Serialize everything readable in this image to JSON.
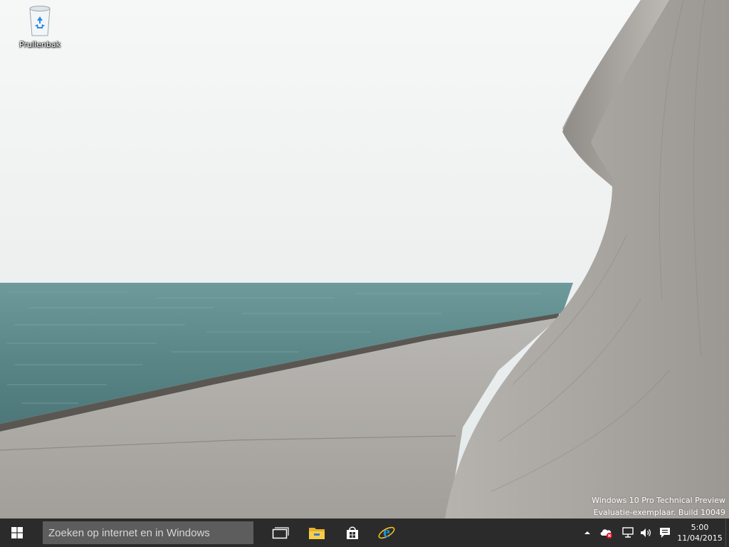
{
  "desktop": {
    "icons": [
      {
        "label": "Prullenbak",
        "icon": "recycle-bin-icon"
      }
    ],
    "watermark": {
      "line1": "Windows 10 Pro Technical Preview",
      "line2": "Evaluatie-exemplaar. Build 10049"
    }
  },
  "taskbar": {
    "start_icon": "windows-logo-icon",
    "search": {
      "placeholder": "Zoeken op internet en in Windows"
    },
    "pinned": [
      {
        "icon": "task-view-icon"
      },
      {
        "icon": "file-explorer-icon"
      },
      {
        "icon": "store-icon"
      },
      {
        "icon": "internet-explorer-icon"
      }
    ],
    "tray": {
      "icons": [
        "chevron-up-icon",
        "onedrive-error-icon",
        "network-icon",
        "volume-icon",
        "action-center-icon"
      ],
      "time": "5:00",
      "date": "11/04/2015"
    }
  },
  "colors": {
    "taskbar": "#2b2b2b",
    "search_box": "#5d5d5d",
    "ie_blue": "#1e90d8",
    "explorer_yellow": "#f1c232"
  }
}
